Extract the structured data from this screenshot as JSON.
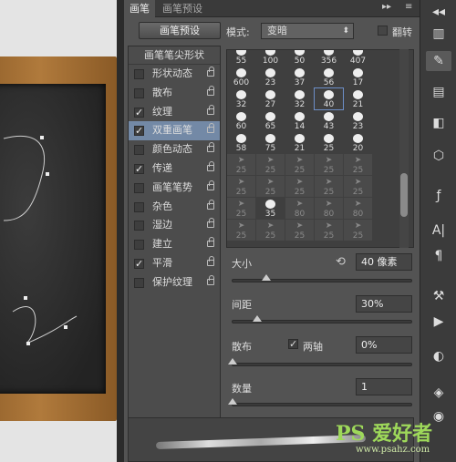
{
  "tabs": {
    "brush": "画笔",
    "brush_presets": "画笔预设",
    "expand": "▸▸",
    "menu": "≡"
  },
  "preset_button": "画笔预设",
  "mode": {
    "label": "模式:",
    "value": "变暗"
  },
  "flip_label": "翻转",
  "left_list": {
    "title": "画笔笔尖形状",
    "items": [
      {
        "label": "形状动态",
        "checked": false
      },
      {
        "label": "散布",
        "checked": false
      },
      {
        "label": "纹理",
        "checked": true
      },
      {
        "label": "双重画笔",
        "checked": true,
        "selected": true
      },
      {
        "label": "颜色动态",
        "checked": false
      },
      {
        "label": "传递",
        "checked": true
      },
      {
        "label": "画笔笔势",
        "checked": false
      },
      {
        "label": "杂色",
        "checked": false
      },
      {
        "label": "湿边",
        "checked": false
      },
      {
        "label": "建立",
        "checked": false
      },
      {
        "label": "平滑",
        "checked": true
      },
      {
        "label": "保护纹理",
        "checked": false
      }
    ]
  },
  "brush_grid": [
    {
      "n": "55",
      "t": "w"
    },
    {
      "n": "100",
      "t": "w"
    },
    {
      "n": "50",
      "t": "w"
    },
    {
      "n": "356",
      "t": "w"
    },
    {
      "n": "407",
      "t": "w"
    },
    {
      "n": "",
      "t": "e"
    },
    {
      "n": "600",
      "t": "w"
    },
    {
      "n": "23",
      "t": "w"
    },
    {
      "n": "37",
      "t": "w"
    },
    {
      "n": "56",
      "t": "w"
    },
    {
      "n": "17",
      "t": "w"
    },
    {
      "n": "",
      "t": "e"
    },
    {
      "n": "32",
      "t": "w"
    },
    {
      "n": "27",
      "t": "w"
    },
    {
      "n": "32",
      "t": "w"
    },
    {
      "n": "40",
      "t": "w",
      "hl": true
    },
    {
      "n": "21",
      "t": "w"
    },
    {
      "n": "",
      "t": "e"
    },
    {
      "n": "60",
      "t": "w"
    },
    {
      "n": "65",
      "t": "w"
    },
    {
      "n": "14",
      "t": "w"
    },
    {
      "n": "43",
      "t": "w"
    },
    {
      "n": "23",
      "t": "w"
    },
    {
      "n": "",
      "t": "e"
    },
    {
      "n": "58",
      "t": "w"
    },
    {
      "n": "75",
      "t": "w"
    },
    {
      "n": "21",
      "t": "w"
    },
    {
      "n": "25",
      "t": "w"
    },
    {
      "n": "20",
      "t": "w"
    },
    {
      "n": "",
      "t": "e"
    },
    {
      "n": "25",
      "t": "g"
    },
    {
      "n": "25",
      "t": "g"
    },
    {
      "n": "25",
      "t": "g"
    },
    {
      "n": "25",
      "t": "g"
    },
    {
      "n": "25",
      "t": "g"
    },
    {
      "n": "",
      "t": "e"
    },
    {
      "n": "25",
      "t": "g"
    },
    {
      "n": "25",
      "t": "g"
    },
    {
      "n": "25",
      "t": "g"
    },
    {
      "n": "25",
      "t": "g"
    },
    {
      "n": "25",
      "t": "g"
    },
    {
      "n": "",
      "t": "e"
    },
    {
      "n": "25",
      "t": "g"
    },
    {
      "n": "35",
      "t": "w"
    },
    {
      "n": "80",
      "t": "g"
    },
    {
      "n": "80",
      "t": "g"
    },
    {
      "n": "80",
      "t": "g"
    },
    {
      "n": "",
      "t": "e"
    },
    {
      "n": "25",
      "t": "g"
    },
    {
      "n": "25",
      "t": "g"
    },
    {
      "n": "25",
      "t": "g"
    },
    {
      "n": "25",
      "t": "g"
    },
    {
      "n": "25",
      "t": "g"
    },
    {
      "n": "",
      "t": "e"
    }
  ],
  "params": {
    "size_label": "大小",
    "size_value": "40 像素",
    "spacing_label": "间距",
    "spacing_value": "30%",
    "scatter_label": "散布",
    "both_axes_label": "两轴",
    "scatter_value": "0%",
    "count_label": "数量",
    "count_value": "1"
  },
  "watermark": {
    "big": "PS 爱好者",
    "small": "www.psahz.com"
  }
}
